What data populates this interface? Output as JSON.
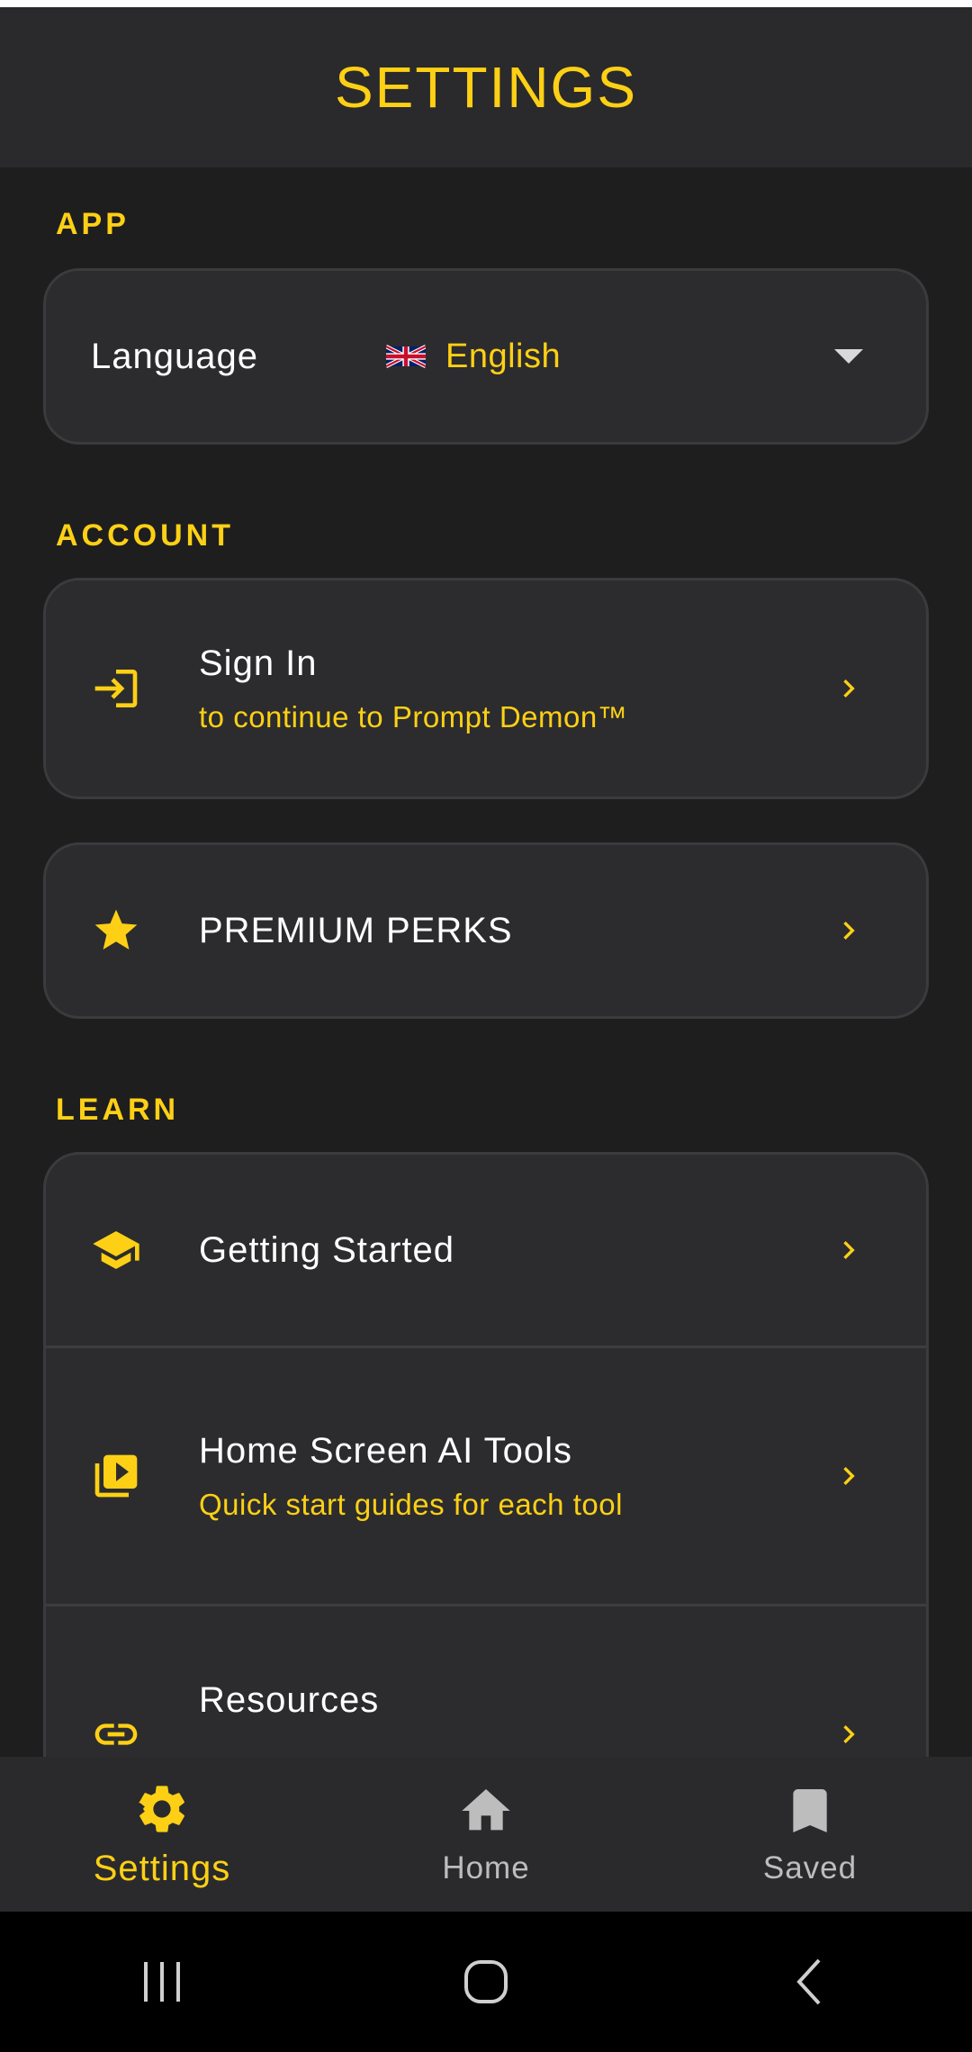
{
  "header": {
    "title": "SETTINGS"
  },
  "sections": {
    "app": {
      "label": "APP"
    },
    "account": {
      "label": "ACCOUNT"
    },
    "learn": {
      "label": "LEARN"
    }
  },
  "language": {
    "label": "Language",
    "flag": "uk-flag",
    "value": "English"
  },
  "account": {
    "sign_in": {
      "title": "Sign In",
      "subtitle": "to continue to Prompt Demon™",
      "icon": "sign-in-icon"
    },
    "premium": {
      "title": "PREMIUM PERKS",
      "icon": "star-icon"
    }
  },
  "learn": {
    "items": [
      {
        "title": "Getting Started",
        "icon": "graduation-cap-icon"
      },
      {
        "title": "Home Screen AI Tools",
        "subtitle": "Quick start guides for each tool",
        "icon": "video-library-icon"
      },
      {
        "title": "Resources",
        "icon": "link-icon"
      }
    ]
  },
  "bottom_nav": {
    "items": [
      {
        "label": "Settings",
        "icon": "gear-icon",
        "active": true
      },
      {
        "label": "Home",
        "icon": "home-icon",
        "active": false
      },
      {
        "label": "Saved",
        "icon": "bookmark-icon",
        "active": false
      }
    ]
  },
  "colors": {
    "accent": "#fdd015",
    "background": "#1e1e1f",
    "card": "#2c2c2e",
    "header": "#2a2a2c"
  }
}
